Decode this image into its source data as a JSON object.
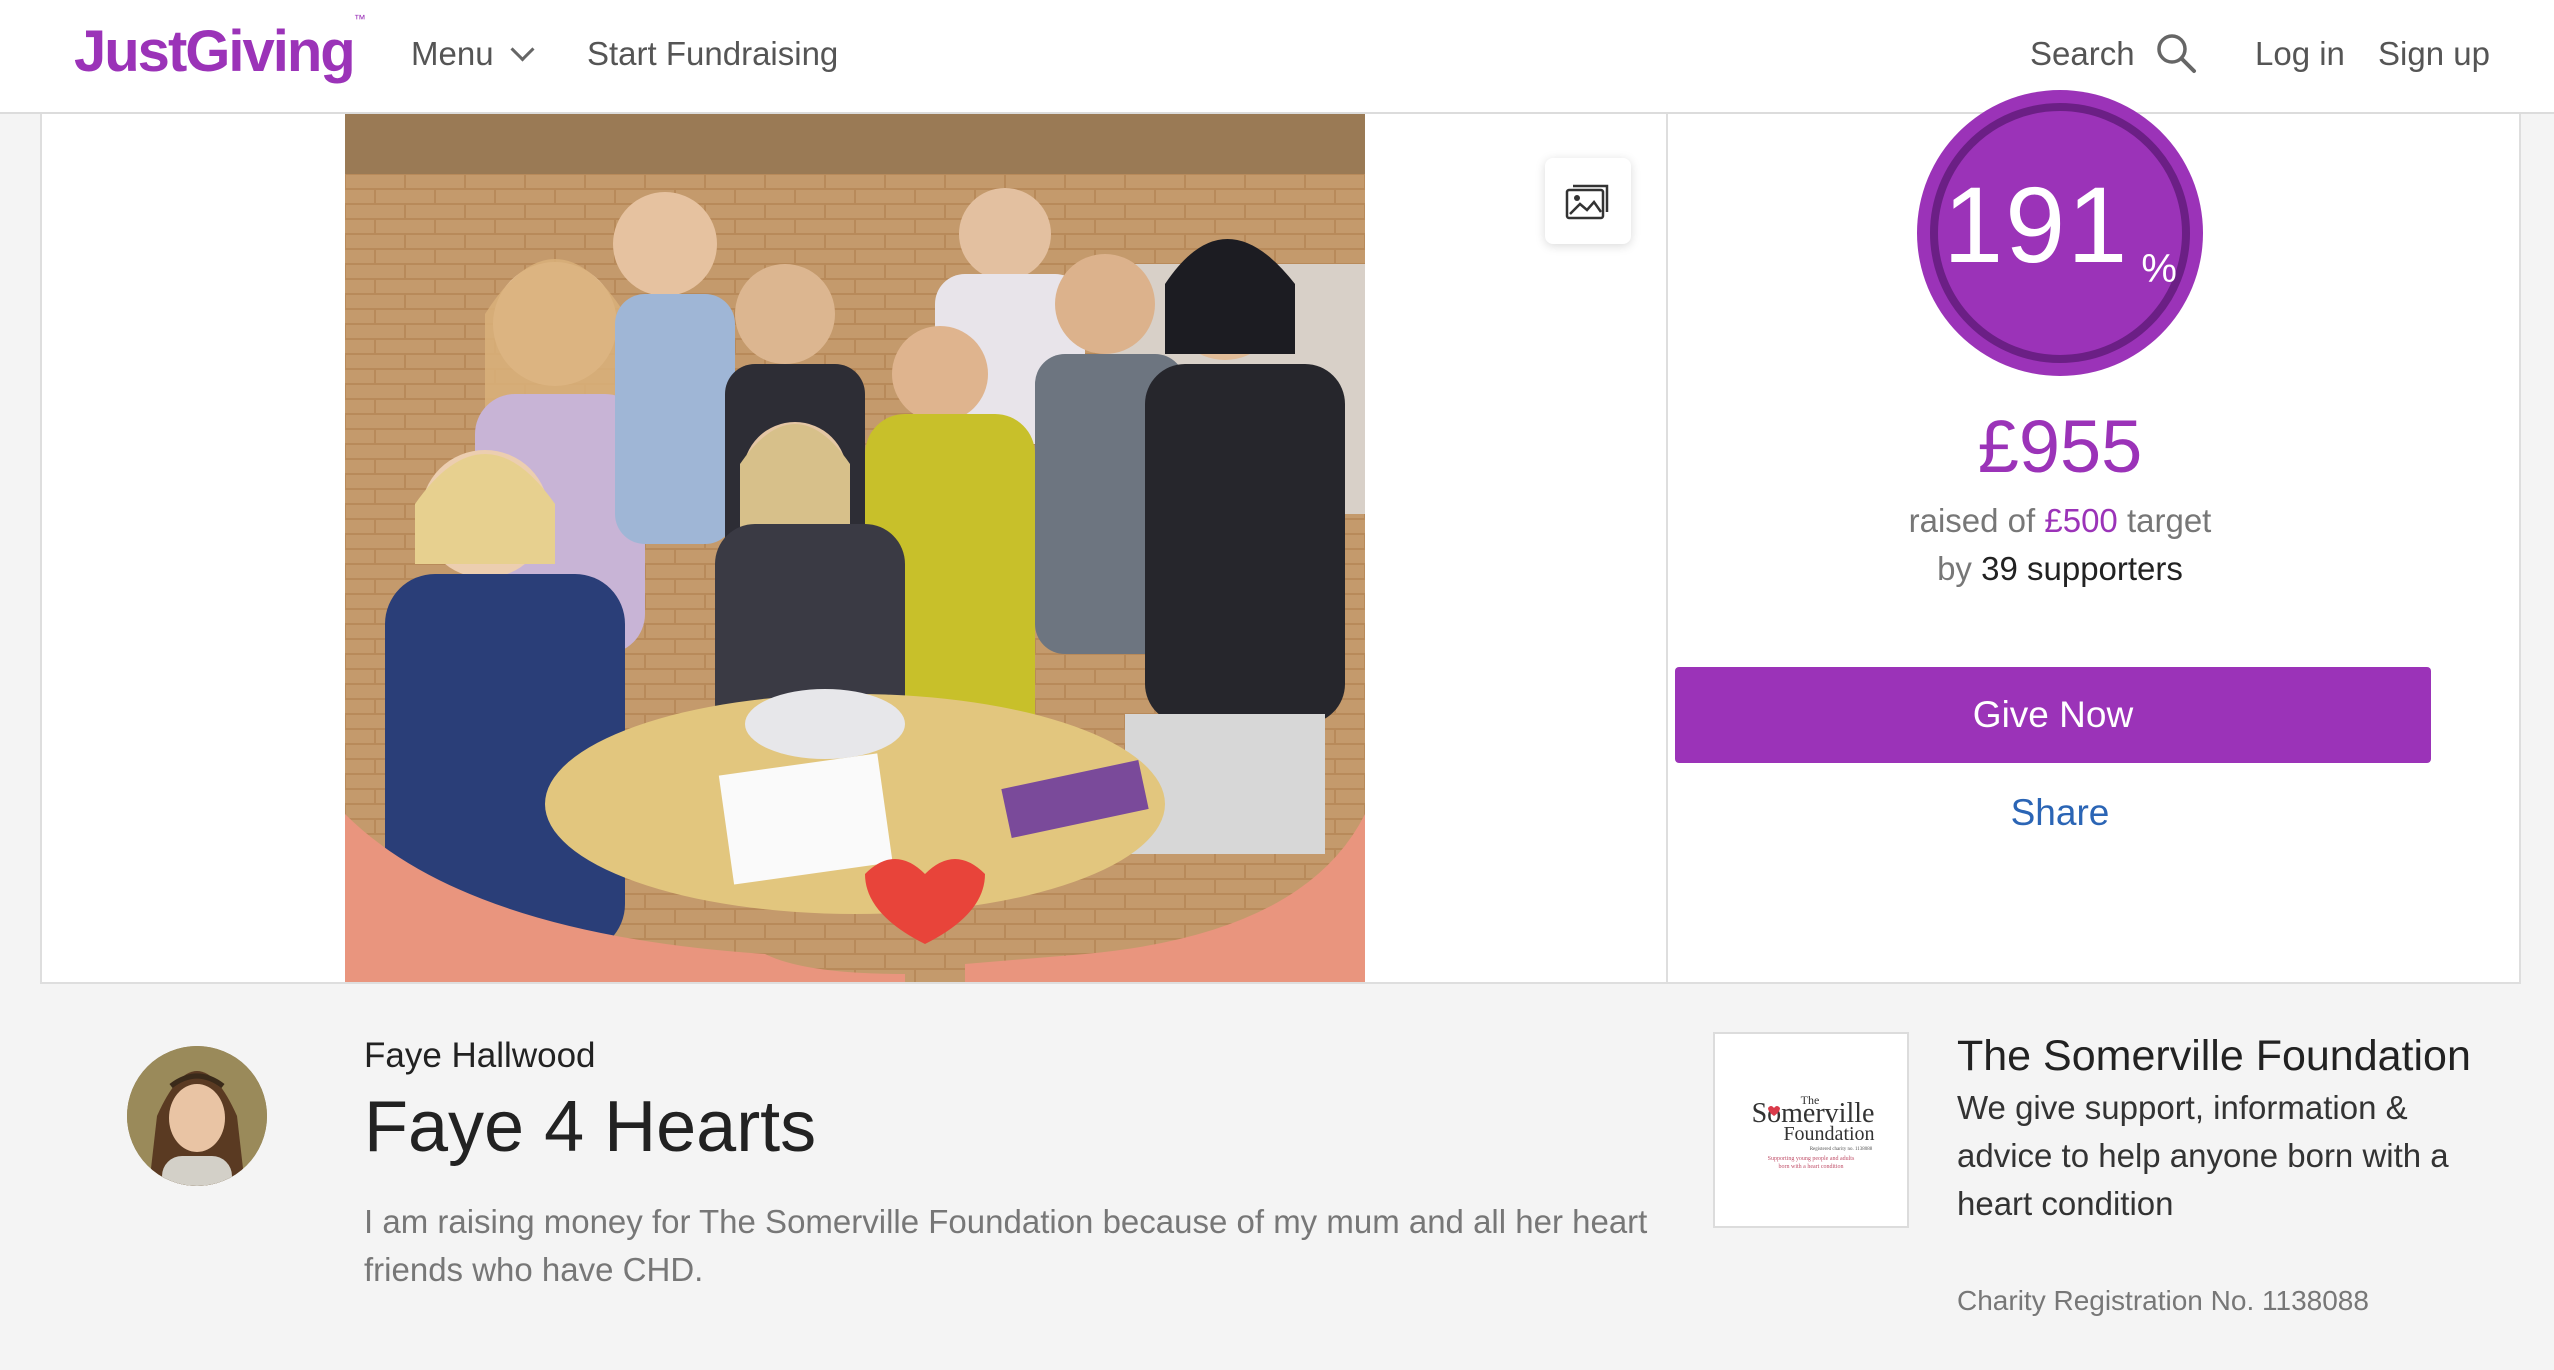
{
  "header": {
    "logo": "JustGiving",
    "logo_mark": "™",
    "menu_label": "Menu",
    "start_fundraising": "Start Fundraising",
    "search_label": "Search",
    "login": "Log in",
    "signup": "Sign up"
  },
  "progress": {
    "percent": "191",
    "percent_sign": "%",
    "percent_value": 1.91,
    "raised": "£955",
    "raised_of": "raised of",
    "target": "£500",
    "target_word": "target",
    "by": "by",
    "supporters": "39 supporters"
  },
  "actions": {
    "give_now": "Give Now",
    "share": "Share"
  },
  "fundraiser": {
    "owner": "Faye Hallwood",
    "title": "Faye 4 Hearts",
    "story": "I am raising money for The Somerville Foundation because of my mum and all her heart friends who have CHD."
  },
  "charity": {
    "name": "The Somerville Foundation",
    "description": "We give support, information & advice to help anyone born with a heart condition",
    "registration": "Charity Registration No. 1138088",
    "logo_the": "The",
    "logo_somerville": "Somerville",
    "logo_foundation": "Foundation",
    "logo_reg": "Registered charity no. 1138088",
    "logo_tagline_1": "Supporting young people and adults",
    "logo_tagline_2": "born with a heart condition"
  },
  "colors": {
    "brand_purple": "#9b33b8",
    "ring_dark": "#6b1f85",
    "link_blue": "#2b65b5"
  },
  "icons": {
    "menu_chevron": "chevron-down-icon",
    "search": "search-icon",
    "gallery": "image-gallery-icon"
  }
}
